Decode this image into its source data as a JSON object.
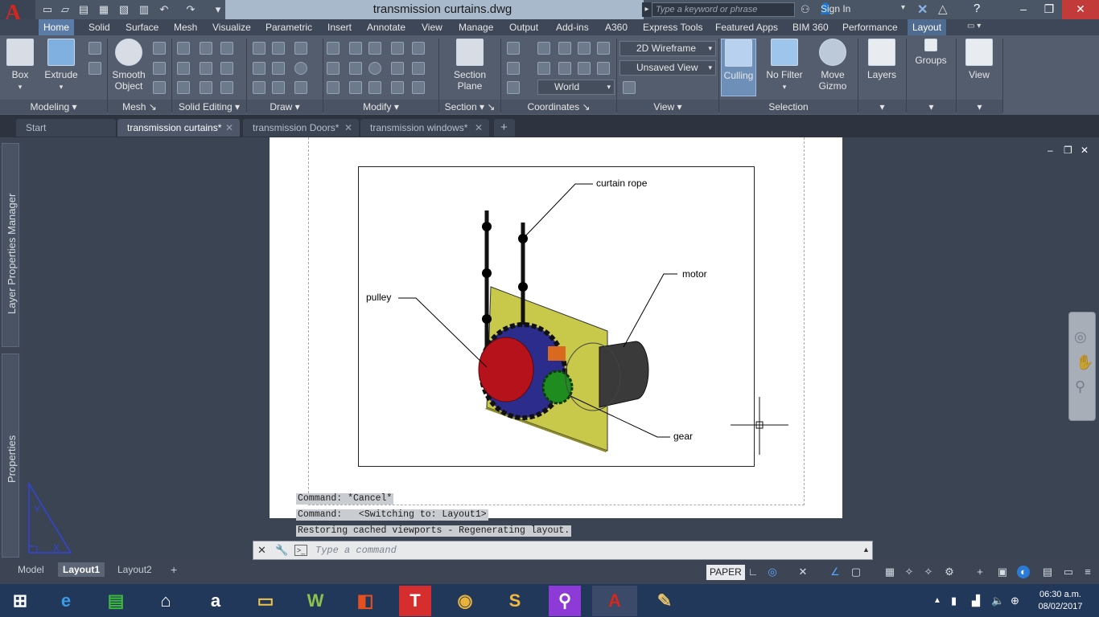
{
  "app": {
    "logo": "A",
    "title": "transmission curtains.dwg",
    "search_placeholder": "Type a keyword or phrase",
    "sign_in": "Sign In"
  },
  "ribbon_tabs": [
    "Home",
    "Solid",
    "Surface",
    "Mesh",
    "Visualize",
    "Parametric",
    "Insert",
    "Annotate",
    "View",
    "Manage",
    "Output",
    "Add-ins",
    "A360",
    "Express Tools",
    "Featured Apps",
    "BIM 360",
    "Performance",
    "Layout"
  ],
  "ribbon": {
    "box": "Box",
    "extrude": "Extrude",
    "smooth_object": "Smooth Object",
    "section_plane": "Section Plane",
    "visual_style": "2D Wireframe",
    "view_state": "Unsaved View",
    "ucs": "World",
    "culling": "Culling",
    "no_filter": "No Filter",
    "move_gizmo": "Move Gizmo",
    "layers": "Layers",
    "groups": "Groups",
    "view_btn": "View",
    "panels": [
      "Modeling",
      "Mesh",
      "Solid Editing",
      "Draw",
      "Modify",
      "Section",
      "Coordinates",
      "View",
      "Selection"
    ]
  },
  "doc_tabs": [
    "Start",
    "transmission curtains*",
    "transmission Doors*",
    "transmission windows*"
  ],
  "side_panels": [
    "Layer Properties Manager",
    "Properties"
  ],
  "drawing_labels": {
    "curtain_rope": "curtain rope",
    "motor": "motor",
    "pulley": "pulley",
    "gear": "gear"
  },
  "command_history": [
    "Command: *Cancel*",
    "Command:   <Switching to: Layout1>",
    "Restoring cached viewports - Regenerating layout."
  ],
  "command_placeholder": "Type a command",
  "layout_tabs": [
    "Model",
    "Layout1",
    "Layout2"
  ],
  "status": {
    "paper": "PAPER"
  },
  "clock": {
    "time": "06:30 a.m.",
    "date": "08/02/2017"
  },
  "colors": {
    "title_band": "#a9b9cc",
    "ribbon": "#535d6d",
    "active_tab": "#5b7ca6",
    "plate": "#c8c84a",
    "pulley": "#b5121b",
    "gear_ring": "#2c2c8c",
    "gear": "#1f8c1f",
    "motor": "#3a3a3a"
  }
}
